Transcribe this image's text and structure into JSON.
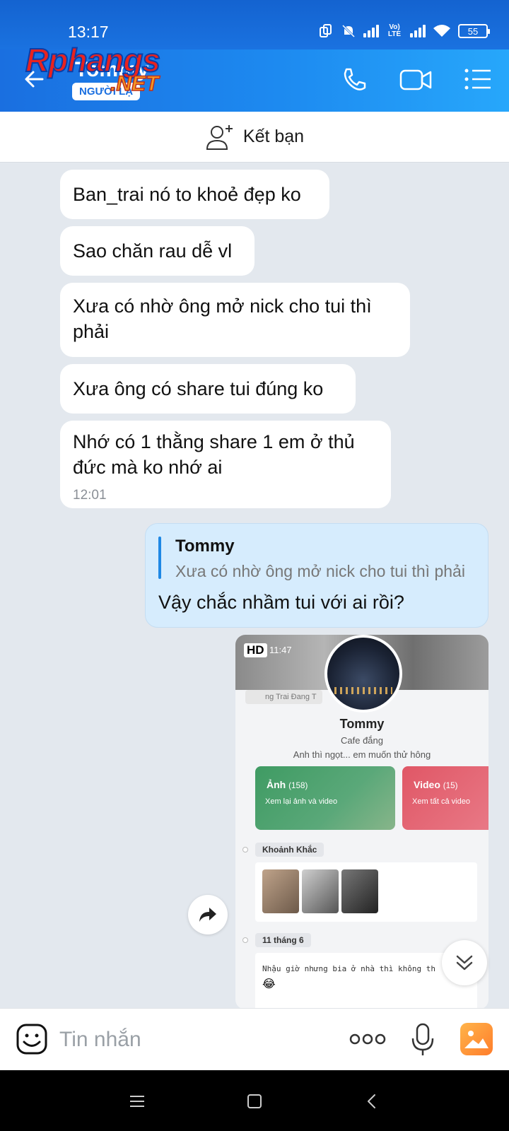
{
  "status_bar": {
    "time": "13:17",
    "lte_label": "Vo) LTE",
    "battery": "55"
  },
  "header": {
    "contact_name": "Tommy",
    "stranger_badge": "NGƯỜI LẠ",
    "watermark_main": "Rphangs",
    "watermark_suffix": ".NET",
    "icons": [
      "back-arrow-icon",
      "phone-icon",
      "video-call-icon",
      "menu-list-icon"
    ]
  },
  "add_friend": {
    "label": "Kết bạn",
    "icon": "add-person-icon"
  },
  "messages": [
    {
      "text": "Ban_trai nó to khoẻ đẹp ko"
    },
    {
      "text": "Sao chăn rau dễ vl"
    },
    {
      "text": "Xưa có nhờ ông mở nick cho tui thì phải"
    },
    {
      "text": "Xưa ông có share tui đúng ko"
    },
    {
      "text": "Nhớ có 1 thằng share 1 em ở thủ đức mà ko nhớ ai",
      "time": "12:01"
    }
  ],
  "sent_reply": {
    "quote_name": "Tommy",
    "quote_text": "Xưa có nhờ ông mở nick cho tui thì phải",
    "text": "Vậy chắc nhầm tui với ai rồi?"
  },
  "shared_image": {
    "hd_badge": "HD",
    "time": "11:47",
    "music": "ng Trai Đang T",
    "profile_name": "Tommy",
    "profile_status": "Cafe đắng",
    "profile_bio": "Anh thì ngọt... em muốn thử hông",
    "photo_card_title": "Ảnh",
    "photo_card_count": "(158)",
    "photo_card_sub": "Xem lại ảnh và video",
    "video_card_title": "Video",
    "video_card_count": "(15)",
    "video_card_sub": "Xem tất cả video",
    "moments_label": "Khoảnh Khắc",
    "date_label": "11 tháng 6",
    "post_text": "Nhậu giờ nhưng bia ở nhà thì không th",
    "post_emoji": "😂"
  },
  "input_bar": {
    "placeholder": "Tin nhắn",
    "icons": [
      "sticker-icon",
      "more-options-icon",
      "microphone-icon",
      "gallery-icon"
    ]
  },
  "nav_bar": {
    "icons": [
      "recents-icon",
      "home-icon",
      "back-icon"
    ]
  },
  "colors": {
    "header_blue": "#1d8af0",
    "sent_bubble": "#d6ecfd",
    "chat_bg": "#e3e8ee",
    "quote_bar": "#1e88e5"
  }
}
